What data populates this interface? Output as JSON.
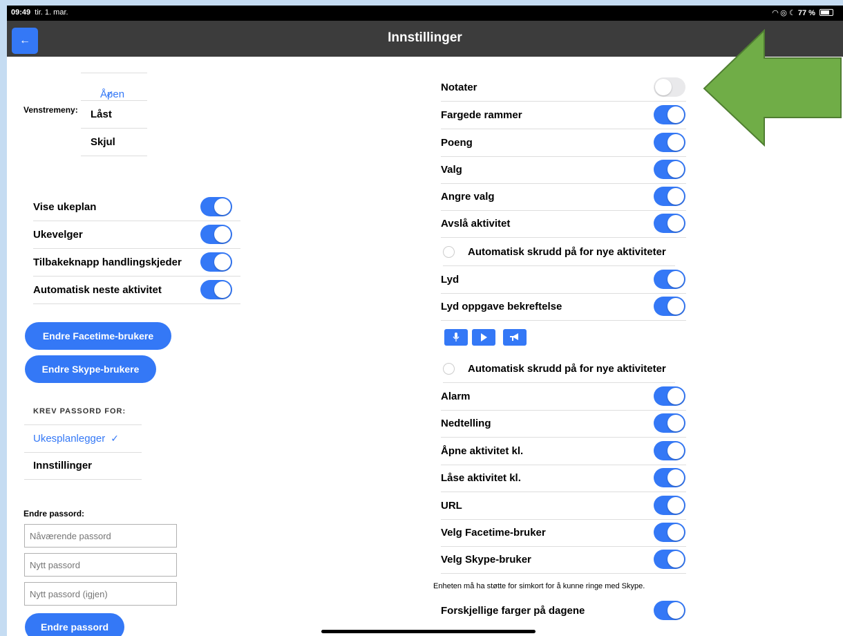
{
  "status": {
    "time": "09:49",
    "date": "tir. 1. mar.",
    "battery": "77 %"
  },
  "nav": {
    "title": "Innstillinger",
    "back_icon": "←"
  },
  "left_menu": {
    "label": "Venstremeny:",
    "options": [
      {
        "label": "Åpen",
        "selected": true
      },
      {
        "label": "Låst",
        "selected": false
      },
      {
        "label": "Skjul",
        "selected": false
      }
    ]
  },
  "left_toggles": [
    {
      "label": "Vise ukeplan",
      "on": true
    },
    {
      "label": "Ukevelger",
      "on": true
    },
    {
      "label": "Tilbakeknapp handlingskjeder",
      "on": true
    },
    {
      "label": "Automatisk neste aktivitet",
      "on": true
    }
  ],
  "buttons": {
    "facetime": "Endre Facetime-brukere",
    "skype": "Endre Skype-brukere",
    "change_password": "Endre passord"
  },
  "password_required": {
    "header": "KREV PASSORD FOR:",
    "options": [
      {
        "label": "Ukesplanlegger",
        "selected": true
      },
      {
        "label": "Innstillinger",
        "selected": false
      }
    ]
  },
  "change_password": {
    "label": "Endre passord:",
    "current_placeholder": "Nåværende passord",
    "new_placeholder": "Nytt passord",
    "repeat_placeholder": "Nytt passord (igjen)"
  },
  "right_toggles_a": [
    {
      "label": "Notater",
      "on": false
    },
    {
      "label": "Fargede rammer",
      "on": true
    },
    {
      "label": "Poeng",
      "on": true
    },
    {
      "label": "Valg",
      "on": true
    },
    {
      "label": "Angre valg",
      "on": true
    },
    {
      "label": "Avslå aktivitet",
      "on": true
    }
  ],
  "auto_dress_1": "Automatisk skrudd på for nye aktiviteter",
  "right_toggles_b": [
    {
      "label": "Lyd",
      "on": true
    },
    {
      "label": "Lyd oppgave bekreftelse",
      "on": true
    }
  ],
  "media_icons": [
    "microphone-icon",
    "play-icon",
    "megaphone-icon"
  ],
  "auto_dress_2": "Automatisk skrudd på for nye aktiviteter",
  "right_toggles_c": [
    {
      "label": "Alarm",
      "on": true
    },
    {
      "label": "Nedtelling",
      "on": true
    },
    {
      "label": "Åpne aktivitet kl.",
      "on": true
    },
    {
      "label": "Låse aktivitet kl.",
      "on": true
    },
    {
      "label": "URL",
      "on": true
    },
    {
      "label": "Velg Facetime-bruker",
      "on": true
    },
    {
      "label": "Velg Skype-bruker",
      "on": true
    }
  ],
  "skype_note": "Enheten må ha støtte for simkort for å kunne ringe med Skype.",
  "right_toggles_d": [
    {
      "label": "Forskjellige farger på dagene",
      "on": true
    }
  ],
  "annotation": {
    "arrow_color": "#70ad47",
    "arrow_stroke": "#507e32"
  }
}
